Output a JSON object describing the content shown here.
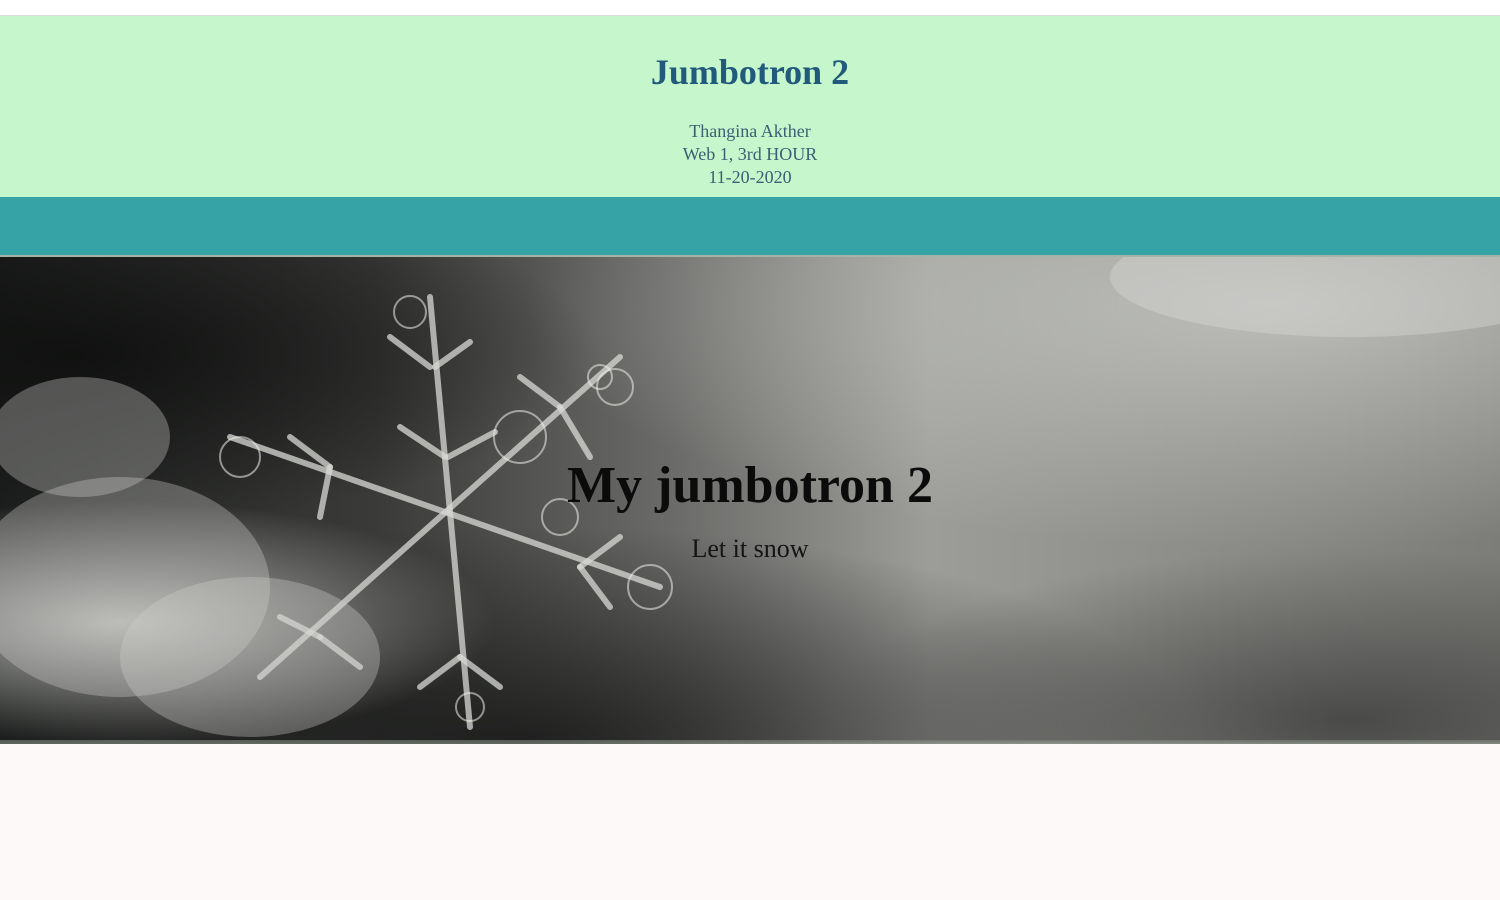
{
  "header": {
    "title": "Jumbotron 2",
    "author": "Thangina Akther",
    "course": "Web 1, 3rd HOUR",
    "date": "11-20-2020"
  },
  "hero": {
    "title": "My jumbotron 2",
    "subtitle": "Let it snow",
    "image_icon": "snowflake-image"
  },
  "colors": {
    "header_bg": "#c6f7cc",
    "header_text": "#215a7a",
    "nav_bg": "#36a3a6",
    "page_bg": "#fdf9f8"
  }
}
